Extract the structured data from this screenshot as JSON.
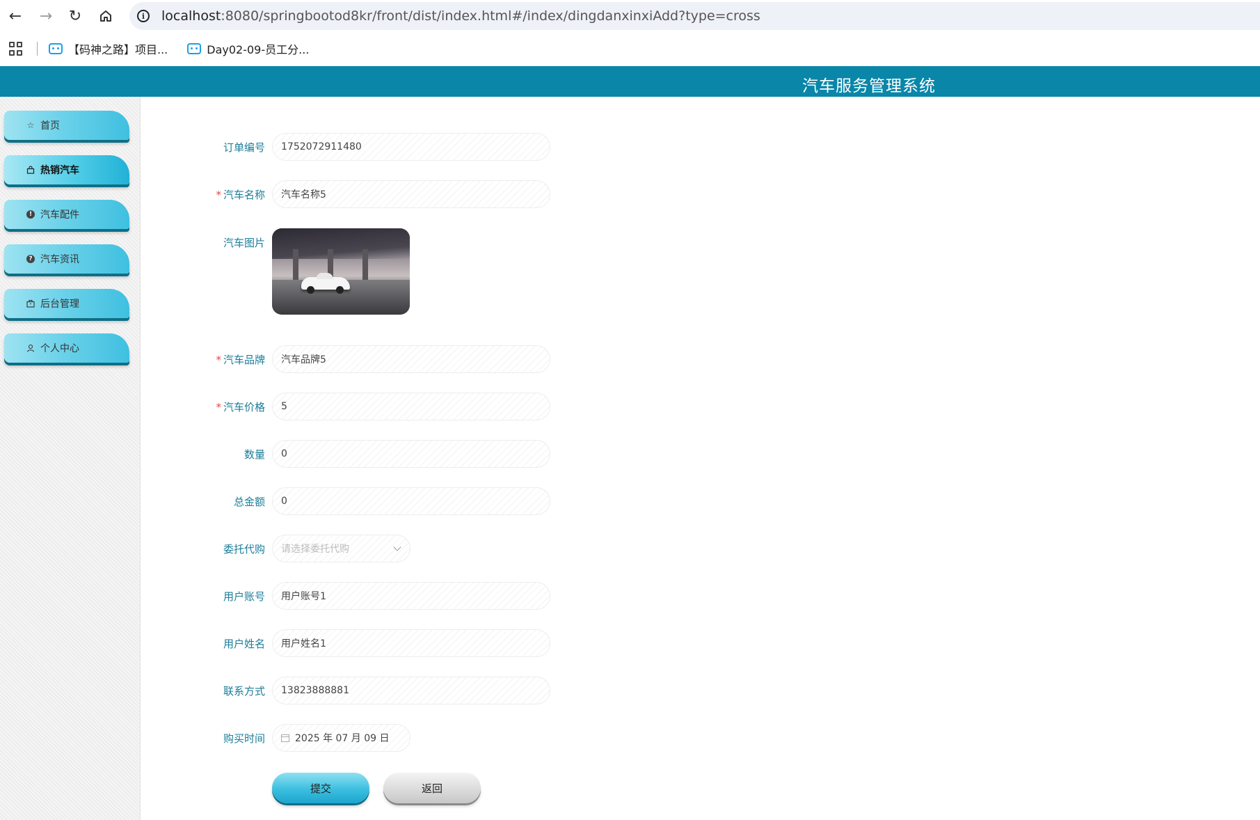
{
  "browser": {
    "url_host": "localhost",
    "url_rest": ":8080/springbootod8kr/front/dist/index.html#/index/dingdanxinxiAdd?type=cross",
    "bookmarks": [
      {
        "label": "【码神之路】项目..."
      },
      {
        "label": "Day02-09-员工分..."
      }
    ]
  },
  "site": {
    "title": "汽车服务管理系统"
  },
  "sidebar": {
    "items": [
      {
        "label": "首页",
        "icon": "star-icon"
      },
      {
        "label": "热销汽车",
        "icon": "bag-icon"
      },
      {
        "label": "汽车配件",
        "icon": "exclamation-icon"
      },
      {
        "label": "汽车资讯",
        "icon": "question-icon"
      },
      {
        "label": "后台管理",
        "icon": "briefcase-icon"
      },
      {
        "label": "个人中心",
        "icon": "user-icon"
      }
    ],
    "active_index": 1
  },
  "form": {
    "order_no": {
      "label": "订单编号",
      "value": "1752072911480"
    },
    "car_name": {
      "label": "汽车名称",
      "value": "汽车名称5",
      "required": true
    },
    "car_image": {
      "label": "汽车图片"
    },
    "car_brand": {
      "label": "汽车品牌",
      "value": "汽车品牌5",
      "required": true
    },
    "car_price": {
      "label": "汽车价格",
      "value": "5",
      "required": true
    },
    "quantity": {
      "label": "数量",
      "value": "0"
    },
    "total": {
      "label": "总金额",
      "value": "0"
    },
    "proxy_purchase": {
      "label": "委托代购",
      "placeholder": "请选择委托代购"
    },
    "user_account": {
      "label": "用户账号",
      "value": "用户账号1"
    },
    "user_name": {
      "label": "用户姓名",
      "value": "用户姓名1"
    },
    "contact": {
      "label": "联系方式",
      "value": "13823888881"
    },
    "purchase_time": {
      "label": "购买时间",
      "value": "2025 年 07 月 09 日"
    },
    "required_mark": "*",
    "submit_label": "提交",
    "back_label": "返回"
  },
  "colors": {
    "header": "#0a86a9",
    "label": "#1b7d98",
    "accent": "#3fc0e0",
    "required": "#e84444"
  }
}
